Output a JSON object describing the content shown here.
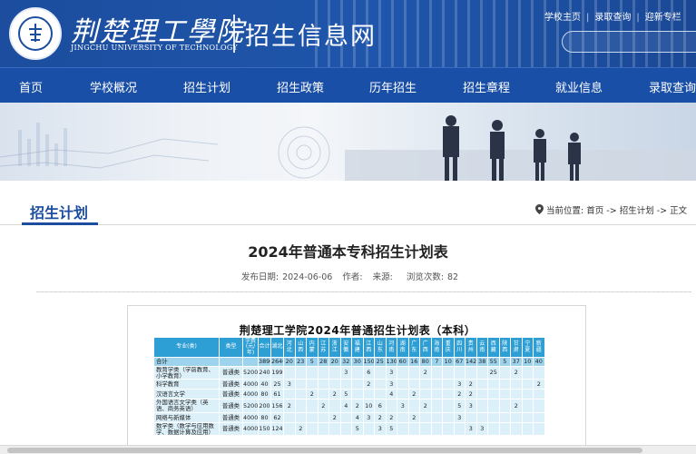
{
  "header": {
    "brand_cn": "荆楚理工學院",
    "brand_en": "JINGCHU UNIVERSITY OF TECHNOLOGY",
    "site_title": "招生信息网",
    "top_links": [
      "学校主页",
      "录取查询",
      "迎新专栏"
    ],
    "separator": "|"
  },
  "nav": {
    "items": [
      "首页",
      "学校概况",
      "招生计划",
      "招生政策",
      "历年招生",
      "招生章程",
      "就业信息",
      "录取查询"
    ]
  },
  "section": {
    "title": "招生计划",
    "breadcrumb": {
      "prefix": "当前位置:",
      "items": [
        "首页",
        "招生计划",
        "正文"
      ],
      "arrow": "->"
    }
  },
  "article": {
    "title": "2024年普通本专科招生计划表",
    "date_label": "发布日期:",
    "date": "2024-06-06",
    "author_label": "作者:",
    "source_label": "来源:",
    "views_label": "浏览次数:",
    "views": "82"
  },
  "table_image": {
    "title": "荆楚理工学院2024年普通招生计划表（本科）",
    "headers": [
      "专业(类)",
      "类型",
      "学费(元/年)",
      "合计",
      "湖北",
      "河北",
      "山西",
      "内蒙",
      "江苏",
      "浙江",
      "安徽",
      "福建",
      "江西",
      "山东",
      "河南",
      "湖南",
      "广东",
      "广西",
      "海南",
      "重庆",
      "四川",
      "贵州",
      "云南",
      "西藏",
      "陕西",
      "甘肃",
      "宁夏",
      "新疆"
    ],
    "total_row": [
      "合计",
      "",
      "",
      "3890",
      "2640",
      "20",
      "23",
      "5",
      "28",
      "20",
      "32",
      "30",
      "150",
      "25",
      "130",
      "60",
      "16",
      "80",
      "7",
      "10",
      "67",
      "142",
      "38",
      "55",
      "5",
      "37",
      "10",
      "40"
    ],
    "rows": [
      [
        "教育学类（学前教育、小学教育）",
        "普通类",
        "5200",
        "240",
        "199",
        "",
        "",
        "",
        "",
        "",
        "3",
        "",
        "6",
        "",
        "3",
        "",
        "",
        "2",
        "",
        "",
        "",
        "",
        "",
        "25",
        "",
        "2",
        "",
        ""
      ],
      [
        "科学教育",
        "普通类",
        "4000",
        "40",
        "25",
        "3",
        "",
        "",
        "",
        "",
        "",
        "",
        "2",
        "",
        "3",
        "",
        "",
        "",
        "",
        "",
        "3",
        "2",
        "",
        "",
        "",
        "",
        "",
        "2"
      ],
      [
        "汉语言文学",
        "普通类",
        "4000",
        "80",
        "61",
        "",
        "",
        "2",
        "",
        "2",
        "5",
        "",
        "",
        "",
        "4",
        "",
        "2",
        "",
        "",
        "",
        "2",
        "2",
        "",
        "",
        "",
        "",
        "",
        ""
      ],
      [
        "外国语言文学类（英语、商务英语）",
        "普通类",
        "5200",
        "200",
        "156",
        "2",
        "",
        "",
        "2",
        "",
        "4",
        "2",
        "10",
        "6",
        "",
        "3",
        "",
        "2",
        "",
        "",
        "5",
        "3",
        "",
        "",
        "",
        "2",
        "",
        ""
      ],
      [
        "网络与新媒体",
        "普通类",
        "4000",
        "80",
        "62",
        "",
        "",
        "",
        "",
        "2",
        "",
        "4",
        "3",
        "2",
        "2",
        "",
        "2",
        "",
        "",
        "",
        "3",
        "",
        "",
        "",
        "",
        "",
        "",
        ""
      ],
      [
        "数学类（数学与应用数学、数据计算及应用）",
        "普通类",
        "4000",
        "150",
        "124",
        "",
        "2",
        "",
        "",
        "",
        "",
        "5",
        "",
        "3",
        "5",
        "",
        "",
        "",
        "",
        "",
        "",
        "3",
        "3",
        "",
        "",
        "",
        "",
        ""
      ]
    ]
  },
  "colors": {
    "header_blue": "#1c4d9e",
    "nav_blue": "#1a4fa8",
    "table_header": "#2e9fd4",
    "table_row": "#dcf0fa"
  },
  "icons": [
    "location-pin-icon",
    "college-seal-icon"
  ]
}
